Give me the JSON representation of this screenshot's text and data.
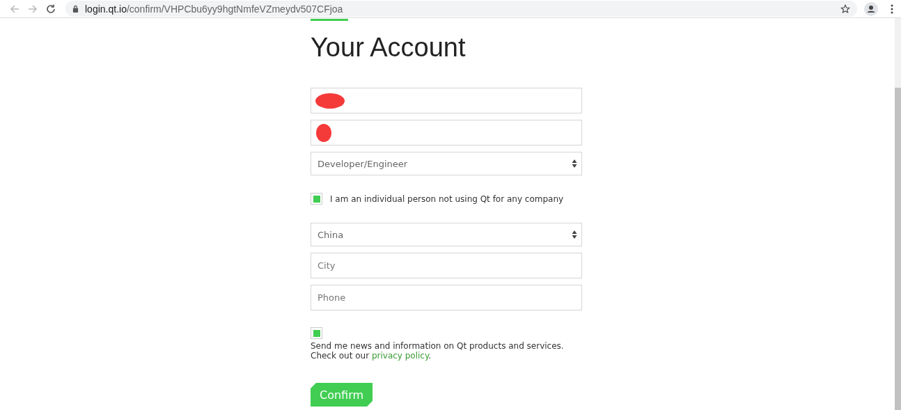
{
  "browser": {
    "url_host": "login.qt.io",
    "url_path": "/confirm/VHPCbu6yy9hgtNmfeVZmeydv507CFjoa"
  },
  "title": "Your Account",
  "fields": [
    {
      "kind": "text",
      "redacted": true
    },
    {
      "kind": "text",
      "redacted": true
    },
    {
      "kind": "select",
      "value": "Developer/Engineer"
    },
    {
      "kind": "checkbox",
      "label": "I am an individual person not using Qt for any company",
      "checked": true
    },
    {
      "kind": "select",
      "value": "China"
    },
    {
      "kind": "text",
      "placeholder": "City"
    },
    {
      "kind": "text",
      "placeholder": "Phone"
    }
  ],
  "consent": {
    "checked": true,
    "text_before": "Send me news and information on Qt products and services. Check out our ",
    "link": "privacy policy",
    "text_after": "."
  },
  "confirm_button": "Confirm"
}
